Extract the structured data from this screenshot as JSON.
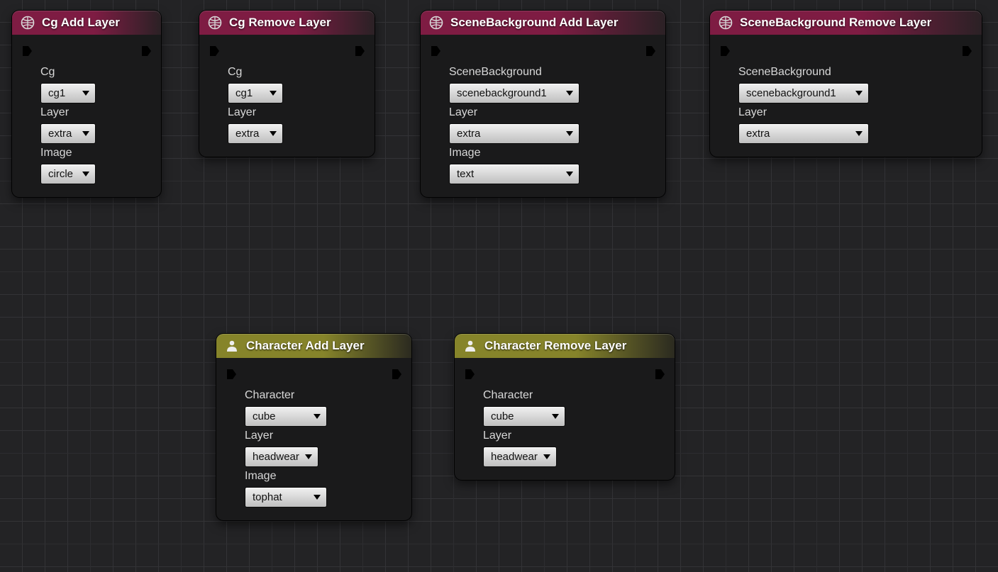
{
  "nodes": {
    "cgAdd": {
      "title": "Cg Add Layer",
      "fields": [
        {
          "label": "Cg",
          "value": "cg1"
        },
        {
          "label": "Layer",
          "value": "extra"
        },
        {
          "label": "Image",
          "value": "circle"
        }
      ]
    },
    "cgRemove": {
      "title": "Cg Remove Layer",
      "fields": [
        {
          "label": "Cg",
          "value": "cg1"
        },
        {
          "label": "Layer",
          "value": "extra"
        }
      ]
    },
    "sbAdd": {
      "title": "SceneBackground Add Layer",
      "fields": [
        {
          "label": "SceneBackground",
          "value": "scenebackground1"
        },
        {
          "label": "Layer",
          "value": "extra"
        },
        {
          "label": "Image",
          "value": "text"
        }
      ]
    },
    "sbRemove": {
      "title": "SceneBackground Remove Layer",
      "fields": [
        {
          "label": "SceneBackground",
          "value": "scenebackground1"
        },
        {
          "label": "Layer",
          "value": "extra"
        }
      ]
    },
    "charAdd": {
      "title": "Character Add Layer",
      "fields": [
        {
          "label": "Character",
          "value": "cube"
        },
        {
          "label": "Layer",
          "value": "headwear"
        },
        {
          "label": "Image",
          "value": "tophat"
        }
      ]
    },
    "charRemove": {
      "title": "Character Remove Layer",
      "fields": [
        {
          "label": "Character",
          "value": "cube"
        },
        {
          "label": "Layer",
          "value": "headwear"
        }
      ]
    }
  }
}
